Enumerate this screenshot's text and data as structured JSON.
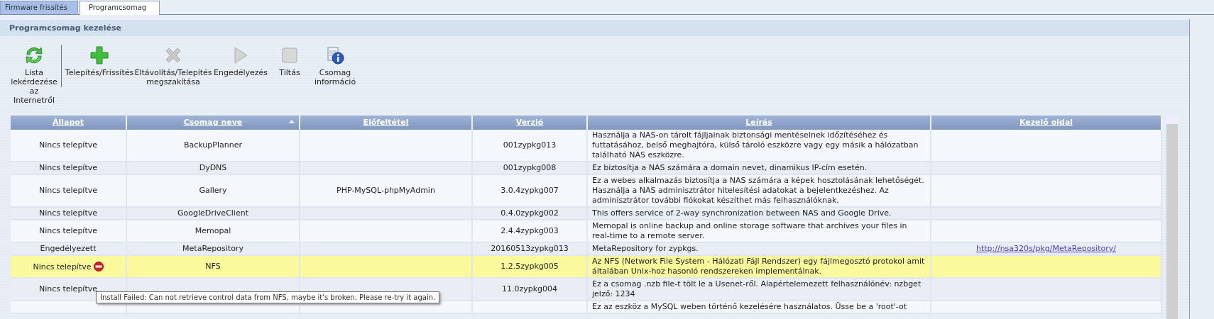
{
  "tabs": [
    {
      "label": "Firmware frissítés",
      "selected": false
    },
    {
      "label": "Programcsomag",
      "selected": true
    }
  ],
  "panel": {
    "title": "Programcsomag kezelése"
  },
  "toolbar": [
    {
      "kind": "refresh",
      "label": "Lista lekérdezése az Internetről",
      "disabled": false
    },
    {
      "kind": "install",
      "label": "Telepítés/Frissítés",
      "disabled": false
    },
    {
      "kind": "remove",
      "label": "Eltávolítás/Telepítés megszakítása",
      "disabled": true
    },
    {
      "kind": "enable",
      "label": "Engedélyezés",
      "disabled": true
    },
    {
      "kind": "disable",
      "label": "Tiltás",
      "disabled": true
    },
    {
      "kind": "info",
      "label": "Csomag információ",
      "disabled": false
    }
  ],
  "table": {
    "columns": [
      {
        "label": "Állapot",
        "sorted": false
      },
      {
        "label": "Csomag neve",
        "sorted": true
      },
      {
        "label": "Előfeltétel",
        "sorted": false
      },
      {
        "label": "Verzió",
        "sorted": false
      },
      {
        "label": "Leírás",
        "sorted": false
      },
      {
        "label": "Kezelő oldal",
        "sorted": false
      }
    ],
    "rows": [
      {
        "status": "Nincs telepítve",
        "name": "BackupPlanner",
        "prerequisite": "",
        "version": "001zypkg013",
        "description": "Használja a NAS-on tárolt fájljainak biztonsági mentéseinek időzítéséhez és futtatásához, belső meghajtóra, külső tároló eszközre vagy egy másik a hálózatban található NAS eszközre.",
        "link": "",
        "selected": false,
        "error": false
      },
      {
        "status": "Nincs telepítve",
        "name": "DyDNS",
        "prerequisite": "",
        "version": "001zypkg008",
        "description": "Ez biztosítja a NAS számára a domain nevet, dinamikus IP-cím esetén.",
        "link": "",
        "selected": false,
        "error": false
      },
      {
        "status": "Nincs telepítve",
        "name": "Gallery",
        "prerequisite": "PHP-MySQL-phpMyAdmin",
        "version": "3.0.4zypkg007",
        "description": "Ez a webes alkalmazás biztosítja a NAS számára a képek hosztolásának lehetőségét. Használja a NAS adminisztrátor hitelesítési adatokat a bejelentkezéshez. Az adminisztrátor további fiókokat készíthet más felhasználóknak.",
        "link": "",
        "selected": false,
        "error": false
      },
      {
        "status": "Nincs telepítve",
        "name": "GoogleDriveClient",
        "prerequisite": "",
        "version": "0.4.0zypkg002",
        "description": "This offers service of 2-way synchronization between NAS and Google Drive.",
        "link": "",
        "selected": false,
        "error": false
      },
      {
        "status": "Nincs telepítve",
        "name": "Memopal",
        "prerequisite": "",
        "version": "2.4.4zypkg003",
        "description": "Memopal is online backup and online storage software that archives your files in real-time to a remote server.",
        "link": "",
        "selected": false,
        "error": false
      },
      {
        "status": "Engedélyezett",
        "name": "MetaRepository",
        "prerequisite": "",
        "version": "20160513zypkg013",
        "description": "MetaRepository for zypkgs.",
        "link": "http://nsa320s/pkg/MetaRepository/",
        "selected": false,
        "error": false
      },
      {
        "status": "Nincs telepítve",
        "name": "NFS",
        "prerequisite": "",
        "version": "1.2.5zypkg005",
        "description": "Az NFS (Network File System - Hálózati Fájl Rendszer) egy fájlmegosztó protokol amit általában Unix-hoz hasonló rendszereken implementálnak.",
        "link": "",
        "selected": true,
        "error": true
      },
      {
        "status": "Nincs telepítve",
        "name": "",
        "prerequisite": "",
        "version": "11.0zypkg004",
        "description": "Ez a csomag .nzb file-t tölt le a Usenet-ről. Alapértelemezett felhasználónév: nzbget jelző: 1234",
        "link": "",
        "selected": false,
        "error": false
      },
      {
        "status": "",
        "name": "",
        "prerequisite": "",
        "version": "",
        "description": "Ez az eszköz a MySQL weben történő kezelésére használatos. Üsse be a 'root'-ot",
        "link": "",
        "selected": false,
        "error": false
      }
    ]
  },
  "tooltip": {
    "text": "Install Failed: Can not retrieve control data from NFS, maybe it's broken. Please re-try it again."
  }
}
